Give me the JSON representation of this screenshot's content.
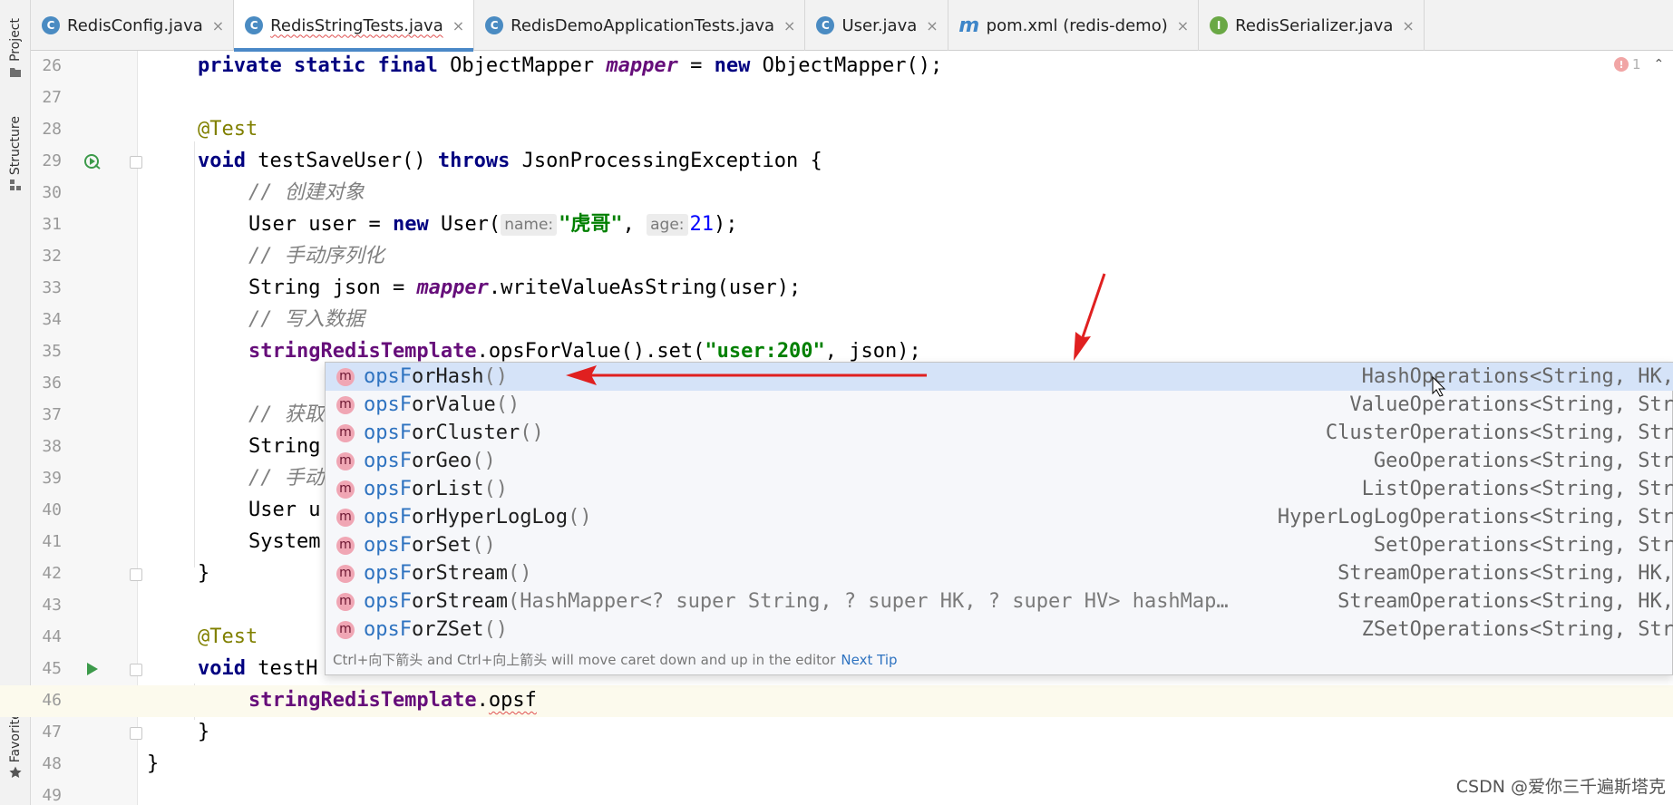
{
  "tool_window_tabs": {
    "project": "Project",
    "structure": "Structure",
    "favorites": "Favorites"
  },
  "editor_tabs": [
    {
      "icon": "C",
      "label": "RedisConfig.java"
    },
    {
      "icon": "C",
      "label": "RedisStringTests.java"
    },
    {
      "icon": "C",
      "label": "RedisDemoApplicationTests.java"
    },
    {
      "icon": "C",
      "label": "User.java"
    },
    {
      "icon": "m",
      "label": "pom.xml (redis-demo)"
    },
    {
      "icon": "I",
      "label": "RedisSerializer.java"
    }
  ],
  "tab_close_glyph": "×",
  "problems_count": "1",
  "line_numbers": [
    "26",
    "27",
    "28",
    "29",
    "30",
    "31",
    "32",
    "33",
    "34",
    "35",
    "36",
    "37",
    "38",
    "39",
    "40",
    "41",
    "42",
    "43",
    "44",
    "45",
    "46",
    "47",
    "48",
    "49"
  ],
  "code": {
    "l26": {
      "kw1": "private static final",
      "type": " ObjectMapper ",
      "fld": "mapper",
      "rest1": " = ",
      "kw2": "new",
      "rest2": " ObjectMapper();"
    },
    "l28": {
      "ann": "@Test"
    },
    "l29": {
      "kw1": "void",
      "mid": " testSaveUser() ",
      "kw2": "throws",
      "rest": " JsonProcessingException {"
    },
    "l30": {
      "cmt": "// 创建对象"
    },
    "l31": {
      "pre": "User user = ",
      "kw": "new",
      "mid": " User(",
      "hint1": "name:",
      "str": "\"虎哥\"",
      "comma": ", ",
      "hint2": "age:",
      "num": "21",
      "end": ");"
    },
    "l32": {
      "cmt": "// 手动序列化"
    },
    "l33": {
      "pre": "String json = ",
      "fld": "mapper",
      "rest": ".writeValueAsString(user);"
    },
    "l34": {
      "cmt": "// 写入数据"
    },
    "l35": {
      "ivar": "stringRedisTemplate",
      "mid": ".opsForValue().set(",
      "str": "\"user:200\"",
      "end": ", json);"
    },
    "l37": {
      "cmt": "// 获取"
    },
    "l38": {
      "text": "String"
    },
    "l39": {
      "cmt": "// 手动"
    },
    "l40": {
      "text": "User u"
    },
    "l41": {
      "text": "System"
    },
    "l42": {
      "text": "}"
    },
    "l44": {
      "ann": "@Test"
    },
    "l45": {
      "kw": "void",
      "rest": " testH"
    },
    "l46": {
      "ivar": "stringRedisTemplate",
      "dot": ".",
      "typed": "opsf"
    },
    "l47": {
      "text": "}"
    },
    "l48": {
      "text": "}"
    }
  },
  "completion": {
    "items": [
      {
        "match": "opsF",
        "rest": "orHash",
        "args": "()",
        "type": "HashOperations<String, HK,"
      },
      {
        "match": "opsF",
        "rest": "orValue",
        "args": "()",
        "type": "ValueOperations<String, Str"
      },
      {
        "match": "opsF",
        "rest": "orCluster",
        "args": "()",
        "type": "ClusterOperations<String, Str"
      },
      {
        "match": "opsF",
        "rest": "orGeo",
        "args": "()",
        "type": "GeoOperations<String, Str"
      },
      {
        "match": "opsF",
        "rest": "orList",
        "args": "()",
        "type": "ListOperations<String, Str"
      },
      {
        "match": "opsF",
        "rest": "orHyperLogLog",
        "args": "()",
        "type": "HyperLogLogOperations<String, Str"
      },
      {
        "match": "opsF",
        "rest": "orSet",
        "args": "()",
        "type": "SetOperations<String, Str"
      },
      {
        "match": "opsF",
        "rest": "orStream",
        "args": "()",
        "type": "StreamOperations<String, HK,"
      },
      {
        "match": "opsF",
        "rest": "orStream",
        "args": "(HashMapper<? super String, ? super HK, ? super HV> hashMap…",
        "type": "StreamOperations<String, HK,"
      },
      {
        "match": "opsF",
        "rest": "orZSet",
        "args": "()",
        "type": "ZSetOperations<String, Str"
      }
    ],
    "item_icon": "m",
    "tip": "Ctrl+向下箭头 and Ctrl+向上箭头 will move caret down and up in the editor",
    "next_tip": "Next Tip"
  },
  "annotation_color": "#e02020",
  "watermark": "CSDN @爱你三千遍斯塔克"
}
